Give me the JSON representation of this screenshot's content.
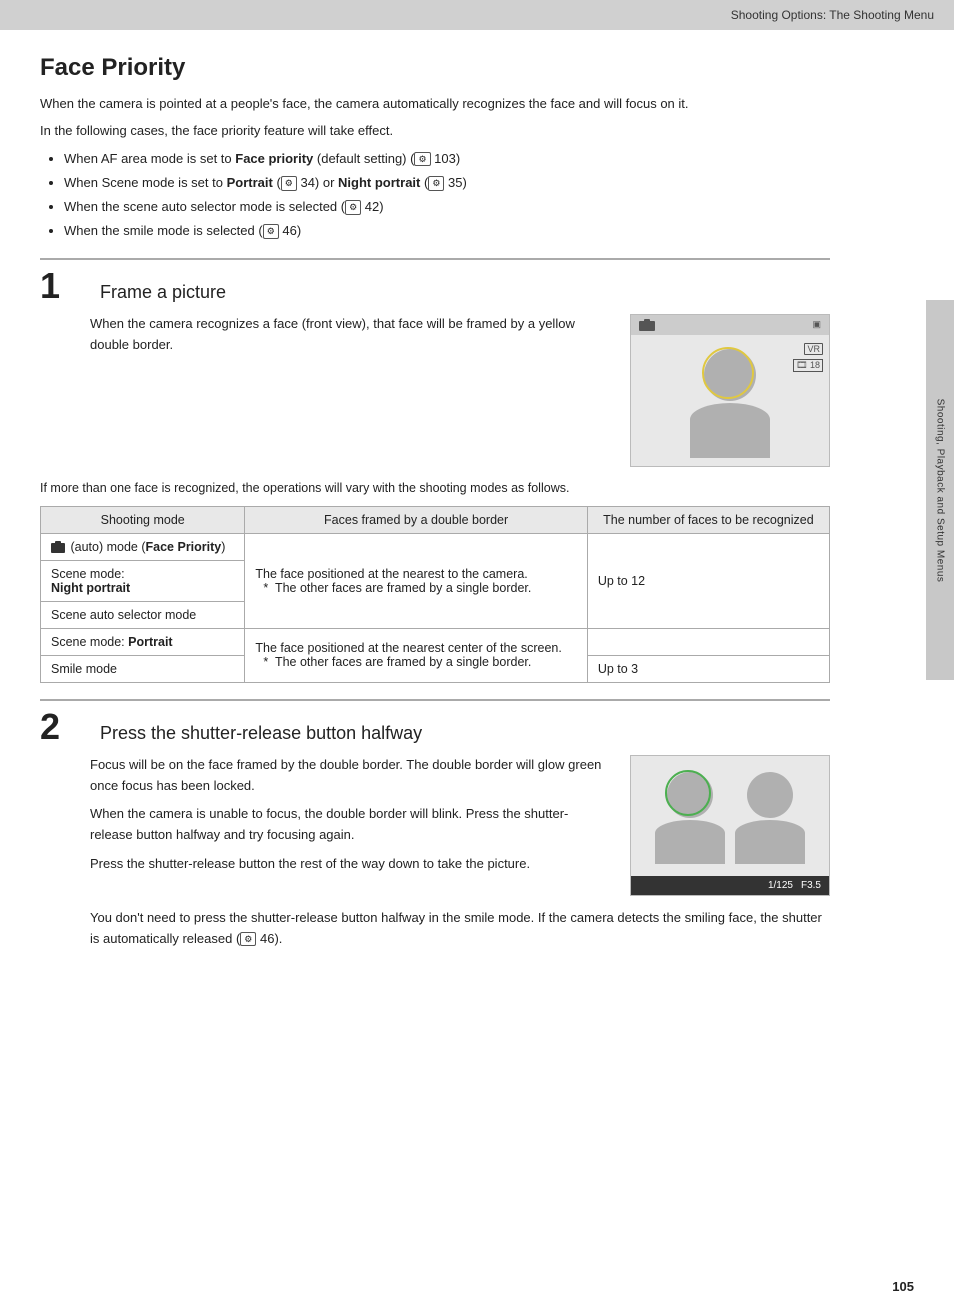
{
  "header": {
    "title": "Shooting Options: The Shooting Menu"
  },
  "page": {
    "number": "105",
    "section_title": "Face Priority",
    "intro": [
      "When the camera is pointed at a people's face, the camera automatically recognizes the face and will focus on it.",
      "In the following cases, the face priority feature will take effect."
    ],
    "bullets": [
      "When AF area mode is set to Face priority (default setting) (  103)",
      "When Scene mode is set to Portrait (  34) or Night portrait (  35)",
      "When the scene auto selector mode is selected (  42)",
      "When the smile mode is selected (  46)"
    ],
    "step1": {
      "number": "1",
      "title": "Frame a picture",
      "body": "When the camera recognizes a face (front view), that face will be framed by a yellow double border.",
      "between_text": "If more than one face is recognized, the operations will vary with the shooting modes as follows.",
      "table": {
        "col1": "Shooting mode",
        "col2": "Faces framed by a double border",
        "col3": "The number of faces to be recognized",
        "rows": [
          {
            "shooting": "(auto) mode (Face Priority)",
            "faces": "The face positioned at the nearest to the camera.\n*  The other faces are framed by a single border.",
            "number": "Up to 12",
            "rowspan_faces": true,
            "rowspan_number": true
          },
          {
            "shooting": "Scene mode:\nNight portrait",
            "faces": "",
            "number": ""
          },
          {
            "shooting": "Scene auto selector mode",
            "faces": "",
            "number": ""
          },
          {
            "shooting": "Scene mode: Portrait",
            "faces": "The face positioned at the nearest center of the screen.\n*  The other faces are framed by a single border.",
            "number": "Up to 3",
            "rowspan_number": false
          },
          {
            "shooting": "Smile mode",
            "faces": "",
            "number": "Up to 3"
          }
        ]
      }
    },
    "step2": {
      "number": "2",
      "title": "Press the shutter-release button halfway",
      "paragraphs": [
        "Focus will be on the face framed by the double border. The double border will glow green once focus has been locked.",
        "When the camera is unable to focus, the double border will blink. Press the shutter-release button halfway and try focusing again.",
        "Press the shutter-release button the rest of the way down to take the picture."
      ],
      "footer": "You don't need to press the shutter-release button halfway in the smile mode. If the camera detects the smiling face, the shutter is automatically released (  46).",
      "camera_values": {
        "shutter": "1/125",
        "aperture": "F3.5"
      }
    },
    "sidebar": "Shooting, Playback and Setup Menus"
  }
}
